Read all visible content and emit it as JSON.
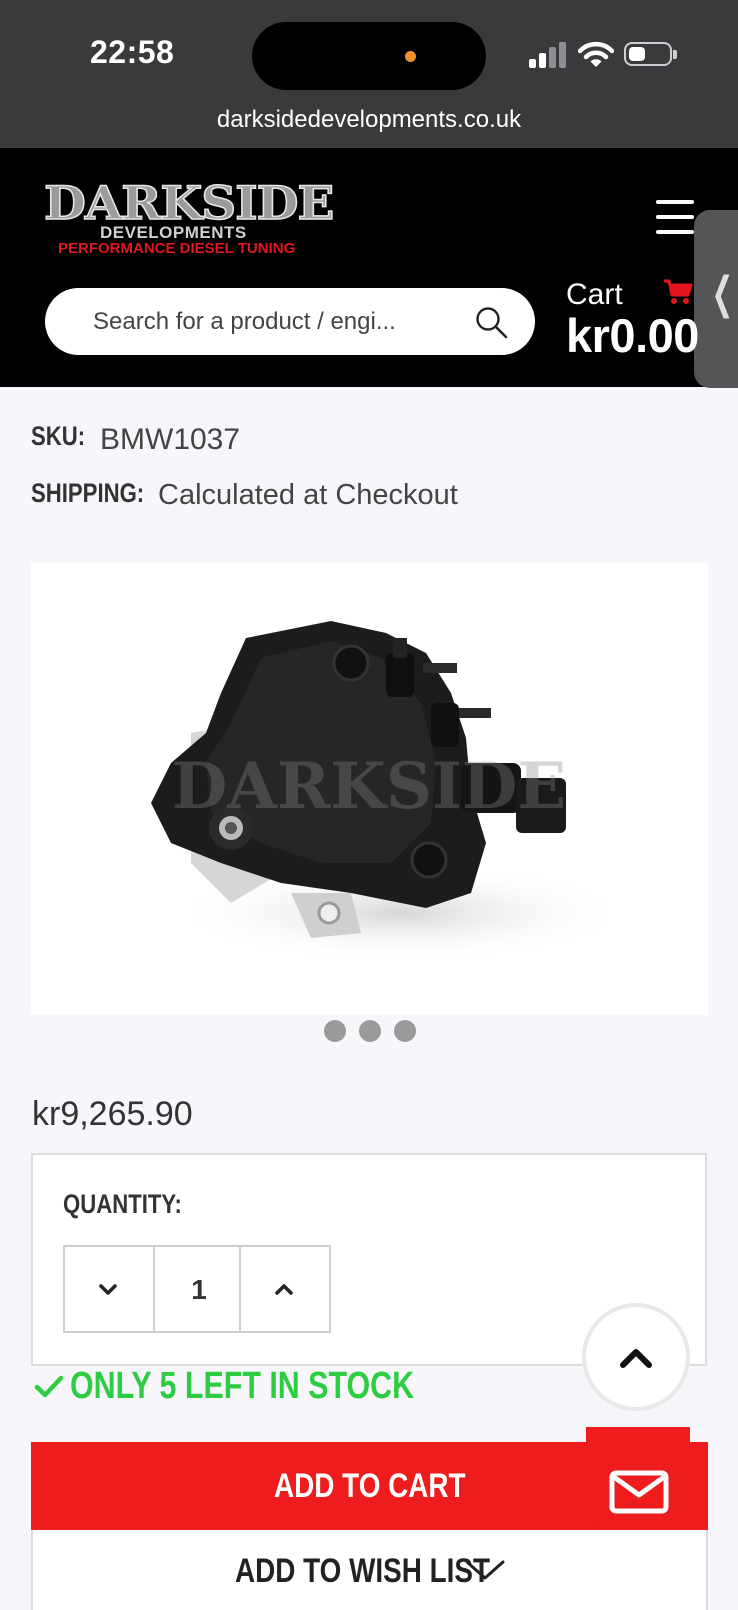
{
  "status_bar": {
    "time": "22:58"
  },
  "browser": {
    "url": "darksidedevelopments.co.uk"
  },
  "header": {
    "logo": {
      "line1": "DARKSIDE",
      "line2": "DEVELOPMENTS",
      "line3": "PERFORMANCE DIESEL TUNING"
    },
    "search": {
      "placeholder": "Search for a product / engi..."
    },
    "cart": {
      "label": "Cart",
      "amount": "kr0.00"
    }
  },
  "product": {
    "sku_label": "SKU:",
    "sku": "BMW1037",
    "shipping_label": "SHIPPING:",
    "shipping": "Calculated at Checkout",
    "image_watermark": "DARKSIDE",
    "carousel_dots": 3,
    "price": "kr9,265.90",
    "quantity_label": "QUANTITY:",
    "quantity": "1",
    "stock": "ONLY 5 LEFT IN STOCK",
    "add_to_cart": "ADD TO CART",
    "add_to_wishlist": "ADD TO WISH LIST"
  },
  "colors": {
    "brand_red": "#ee1c1c",
    "stock_green": "#2ecc40",
    "header_bg": "#000000"
  }
}
